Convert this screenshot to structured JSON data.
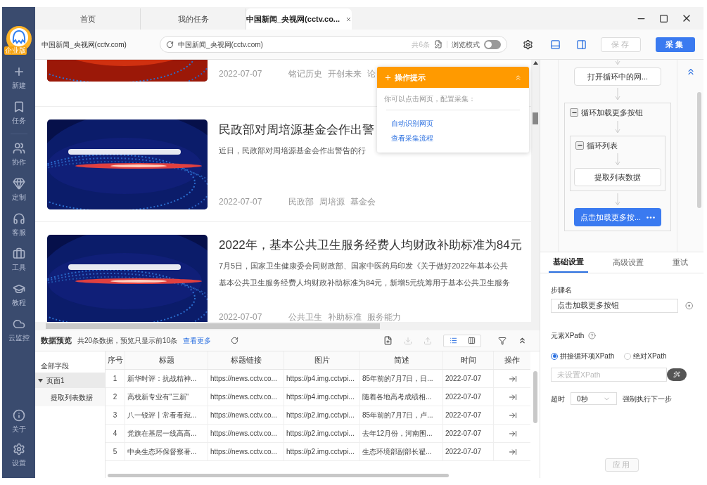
{
  "sidebar": {
    "logo_badge": "企业版",
    "items": [
      {
        "label": "新建"
      },
      {
        "label": "任务"
      },
      {
        "label": "协作"
      },
      {
        "label": "定制"
      },
      {
        "label": "客服"
      },
      {
        "label": "工具"
      },
      {
        "label": "教程"
      },
      {
        "label": "云监控"
      }
    ],
    "bottom_items": [
      {
        "label": "关于"
      },
      {
        "label": "设置"
      }
    ]
  },
  "tabs": [
    {
      "label": "首页",
      "selected": false
    },
    {
      "label": "我的任务",
      "selected": false
    },
    {
      "label": "中国新闻_央视网(cctv.co...",
      "selected": true
    }
  ],
  "address_bar": {
    "page_title": "中国新闻_央视网(cctv.com)",
    "url": "中国新闻_央视网(cctv.com)",
    "count": "共6条",
    "browse_mode_label": "浏览模式",
    "browse_mode_on": false
  },
  "toolbar": {
    "save": {
      "label": "保存",
      "disabled": true
    },
    "collect": {
      "label": "采集"
    }
  },
  "articles": [
    {
      "date": "2022-07-07",
      "tags": [
        "铭记历史",
        "开创未来",
        "论"
      ]
    },
    {
      "title": "民政部对周培源基金会作出警",
      "desc": [
        "近日，民政部对周培源基金会作出警告的行"
      ],
      "date": "2022-07-07",
      "tags": [
        "民政部",
        "周培源",
        "基金会"
      ]
    },
    {
      "title": "2022年，基本公共卫生服务经费人均财政补助标准为84元",
      "desc": [
        "7月5日，国家卫生健康委会同财政部、国家中医药局印发《关于做好2022年基本公共",
        "基本公共卫生服务经费人均财政补助标准为84元，新增5元统筹用于基本公共卫生服务"
      ],
      "date": "2022-07-07",
      "tags": [
        "公共卫生",
        "补助标准",
        "服务能力"
      ]
    }
  ],
  "tip": {
    "title": "操作提示",
    "text": "你可以点击网页，配置采集：",
    "links": [
      "自动识别网页",
      "查看采集流程"
    ]
  },
  "preview": {
    "title": "数据预览",
    "summary": "共20条数据，预览只显示前10条",
    "more": "查看更多",
    "view_modes": [
      {
        "selected": true
      },
      {
        "selected": false
      }
    ],
    "tree": {
      "label": "全部字段",
      "pages": [
        {
          "label": "页面1",
          "expanded": true,
          "selected": true,
          "children": [
            {
              "label": "提取列表数据"
            }
          ]
        }
      ]
    },
    "columns": [
      "序号",
      "标题",
      "标题链接",
      "图片",
      "简述",
      "时间",
      "操作"
    ],
    "rows": [
      [
        "1",
        "新华时评：抗战精神...",
        "https://news.cctv.co...",
        "https://p4.img.cctvpi...",
        "85年前的7月7日，日...",
        "2022-07-07"
      ],
      [
        "2",
        "高校新专业有\"三新\"",
        "https://news.cctv.co...",
        "https://p4.img.cctvpi...",
        "随着各地高考成绩相...",
        "2022-07-07"
      ],
      [
        "3",
        "八一锐评丨常看看宛...",
        "https://news.cctv.co...",
        "https://p2.img.cctvpi...",
        "85年前的7月7日，卢...",
        "2022-07-07"
      ],
      [
        "4",
        "党旗在基层一线高高...",
        "https://news.cctv.co...",
        "https://p2.img.cctvpi...",
        "去年12月份，河南围...",
        "2022-07-07"
      ],
      [
        "5",
        "中央生态环保督察著...",
        "https://news.cctv.co...",
        "https://p2.img.cctvpi...",
        "生态环境部副部长翟...",
        "2022-07-07"
      ]
    ]
  },
  "flow": [
    {
      "kind": "step",
      "label": "打开循环中的网...",
      "selected": false
    },
    {
      "kind": "loop",
      "label": "循环加载更多按钮",
      "expanded": true,
      "children": [
        {
          "kind": "loop",
          "label": "循环列表",
          "expanded": true,
          "children": [
            {
              "kind": "step",
              "label": "提取列表数据",
              "selected": false
            }
          ]
        },
        {
          "kind": "step",
          "label": "点击加载更多按...",
          "selected": true
        }
      ]
    }
  ],
  "settings": {
    "tabs": [
      {
        "label": "基础设置",
        "selected": true
      },
      {
        "label": "高级设置",
        "selected": false
      },
      {
        "label": "重试",
        "selected": false
      }
    ],
    "step_name_label": "步骤名",
    "step_name": "点击加载更多按钮",
    "xpath_label": "元素XPath",
    "xpath_modes": [
      {
        "label": "拼接循环项XPath",
        "selected": true
      },
      {
        "label": "绝对XPath",
        "selected": false
      }
    ],
    "xpath_placeholder": "未设置XPath",
    "timeout_label": "超时",
    "timeout": "0秒",
    "force_next_label": "强制执行下一步",
    "apply": {
      "label": "应用",
      "disabled": true
    }
  }
}
